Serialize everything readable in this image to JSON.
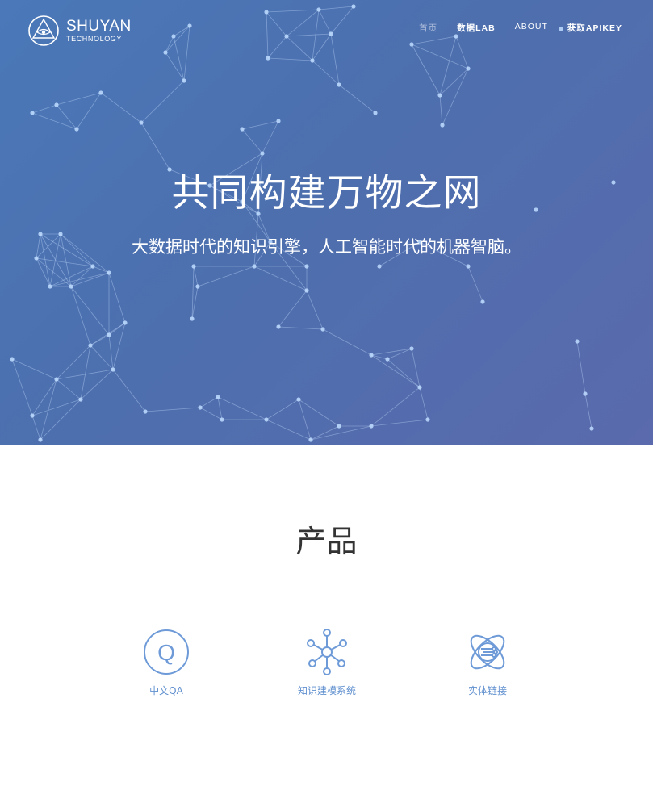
{
  "brand": {
    "name": "SHUYAN",
    "tagline": "TECHNOLOGY"
  },
  "nav": [
    {
      "label": "首页"
    },
    {
      "label": "数据LAB"
    },
    {
      "label": "ABOUT"
    },
    {
      "label": "获取APIKEY"
    }
  ],
  "hero": {
    "title": "共同构建万物之网",
    "subtitle": "大数据时代的知识引擎，人工智能时代的机器智脑。"
  },
  "products": {
    "title": "产品",
    "items": [
      {
        "label": "中文QA",
        "icon": "qa-icon"
      },
      {
        "label": "知识建模系统",
        "icon": "knowledge-graph-icon"
      },
      {
        "label": "实体链接",
        "icon": "entity-link-icon"
      }
    ]
  },
  "colors": {
    "hero_gradient_start": "#4a78b8",
    "hero_gradient_end": "#5a6aac",
    "accent": "#5f8fcf",
    "heading": "#333333"
  }
}
